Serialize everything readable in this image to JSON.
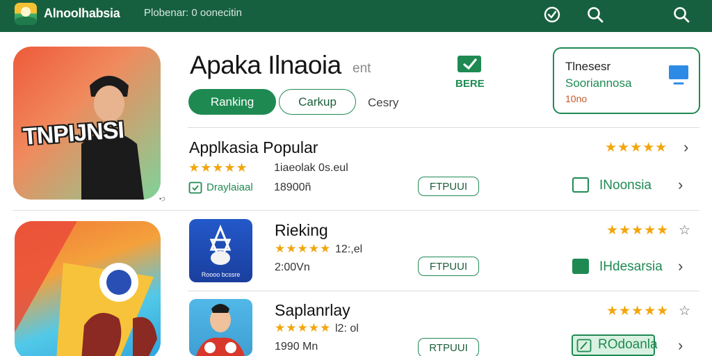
{
  "header": {
    "title": "Alnoolhabsia",
    "subtitle": "Plobenar: 0 oonecitin",
    "icons": [
      "check-circle-icon",
      "search-icon",
      "search-icon"
    ]
  },
  "hero": {
    "tile_text": "TNPIJNSI",
    "ack": "•੭"
  },
  "app": {
    "title": "Apaka Ilnaoia",
    "title_suffix": "ent",
    "tabs": [
      {
        "label": "Ranking",
        "active": true
      },
      {
        "label": "Carkup",
        "active": false
      },
      {
        "label": "Cesry",
        "active": false
      }
    ],
    "action_label": "BERE"
  },
  "side_card": {
    "title": "Tlnesesr",
    "subtitle": "Sooriannosa",
    "meta": "10no"
  },
  "rows": [
    {
      "title": "Applkasia Popular",
      "stars": "★★★★★",
      "right_stars": "★★★★★",
      "meta": "1iaeolak 0s.eul",
      "badge": "Draylaiaal",
      "size": "18900ñ",
      "button": "FTPUUI",
      "region": "INoonsia"
    },
    {
      "title": "Rieking",
      "stars": "★★★★★",
      "right_stars": "★★★★★",
      "meta": "12:,el",
      "size": "2:00Vn",
      "button": "FTPUUI",
      "region": "IHdesarsia",
      "icon_caption": "Roooo bcssre"
    },
    {
      "title": "Saplanrlay",
      "stars": "★★★★★",
      "right_stars": "★★★★★",
      "meta": "l2: ol",
      "size": "1990 Mn",
      "button": "RTPUUI",
      "region": "ROdoanla"
    }
  ],
  "colors": {
    "topbar": "#17603f",
    "accent": "#1e8a52",
    "star": "#f2a60c"
  }
}
